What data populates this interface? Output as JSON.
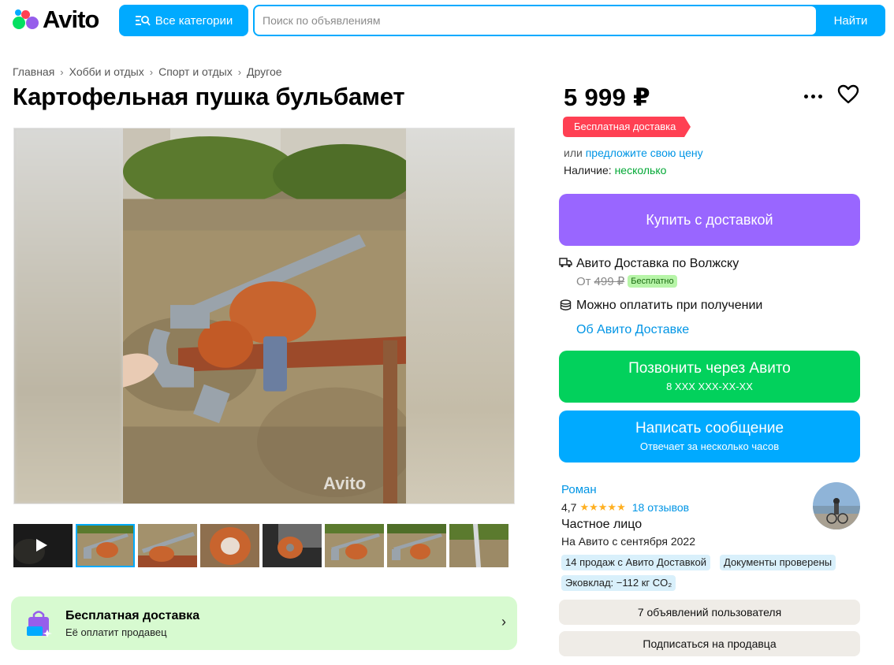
{
  "header": {
    "logo_text": "Avito",
    "categories_button": "Все категории",
    "search_placeholder": "Поиск по объявлениям",
    "search_button": "Найти"
  },
  "breadcrumb": [
    "Главная",
    "Хобби и отдых",
    "Спорт и отдых",
    "Другое"
  ],
  "title": "Картофельная пушка бульбамет",
  "gallery": {
    "watermark": "Avito",
    "thumbnail_count": 8,
    "active_index": 1
  },
  "free_delivery_banner": {
    "title": "Бесплатная доставка",
    "subtitle": "Её оплатит продавец"
  },
  "price": {
    "value": "5 999 ₽",
    "delivery_tag": "Бесплатная доставка",
    "offer_prefix": "или",
    "offer_link": "предложите свою цену",
    "availability_label": "Наличие:",
    "availability_value": "несколько"
  },
  "buy_button": "Купить с доставкой",
  "delivery": {
    "title": "Авито Доставка по Волжску",
    "from": "От",
    "old_price": "499 ₽",
    "free_badge": "Бесплатно",
    "pay_on_receipt": "Можно оплатить при получении",
    "about_link": "Об Авито Доставке"
  },
  "call_button": {
    "label": "Позвонить через Авито",
    "phone": "8 XXX XXX-XX-XX"
  },
  "message_button": {
    "label": "Написать сообщение",
    "sublabel": "Отвечает за несколько часов"
  },
  "seller": {
    "name": "Роман",
    "rating": "4,7",
    "stars": "★★★★★",
    "reviews": "18 отзывов",
    "type": "Частное лицо",
    "since": "На Авито с сентября 2022",
    "chips": [
      "14 продаж с Авито Доставкой",
      "Документы проверены",
      "Эковклад: −112 кг CO₂"
    ],
    "listings_button": "7 объявлений пользователя",
    "subscribe_button": "Подписаться на продавца"
  },
  "colors": {
    "brand_blue": "#00aaff",
    "buy_purple": "#9966ff",
    "call_green": "#02d15c",
    "tag_red": "#ff4053",
    "banner_green": "#d7fad0"
  }
}
